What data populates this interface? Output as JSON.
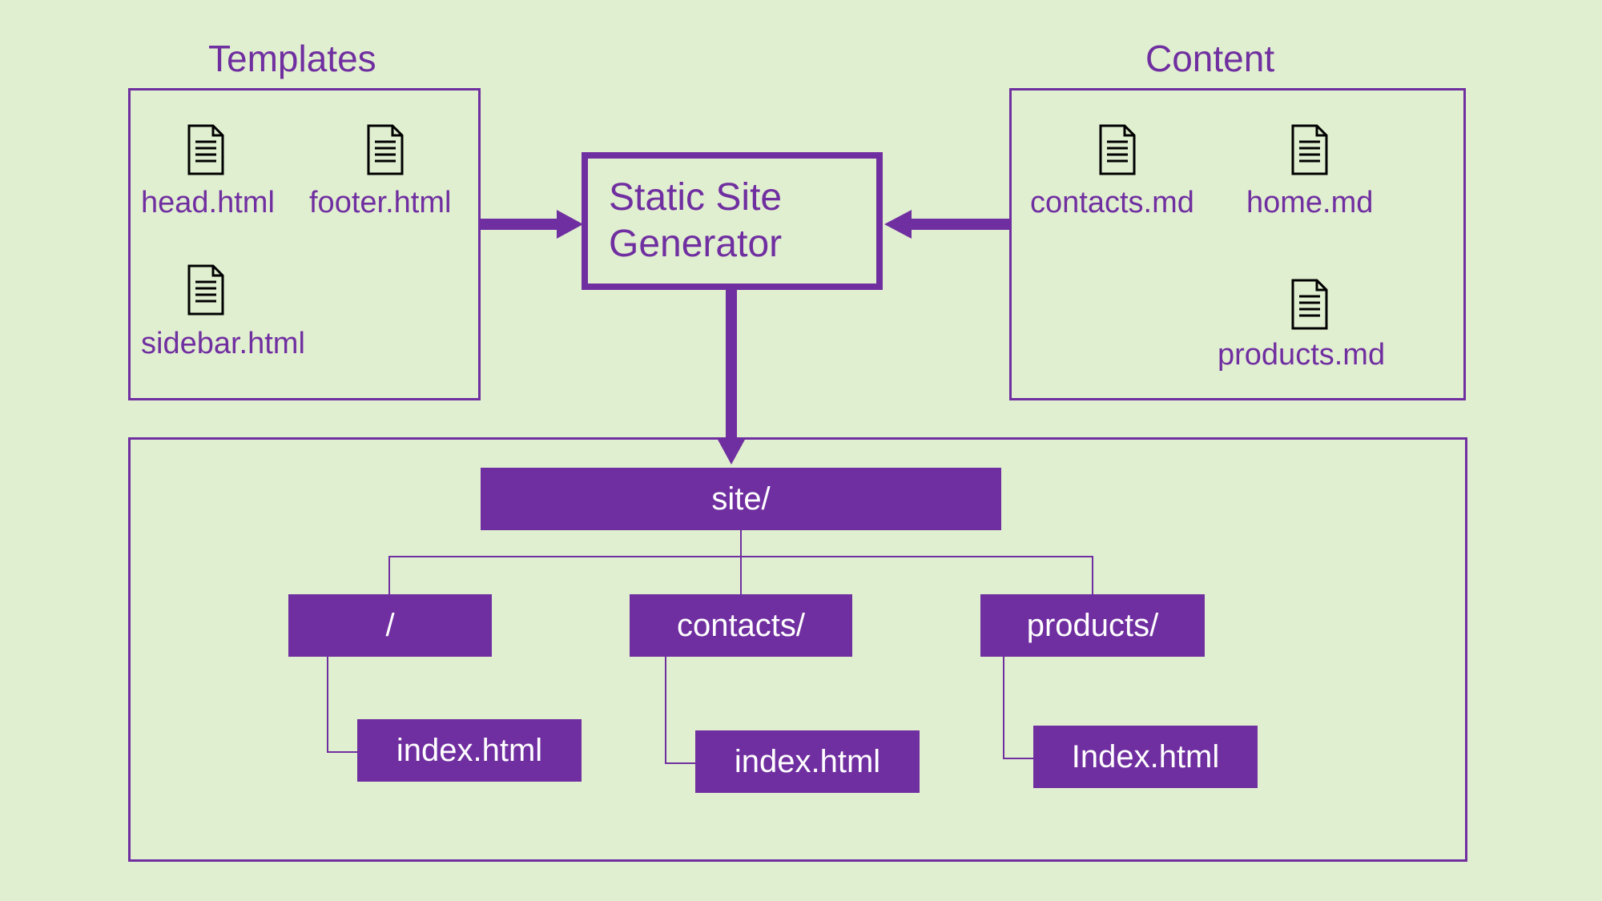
{
  "headings": {
    "templates": "Templates",
    "content": "Content"
  },
  "center": {
    "line1": "Static Site",
    "line2": "Generator"
  },
  "templates": {
    "files": [
      "head.html",
      "footer.html",
      "sidebar.html"
    ]
  },
  "content": {
    "files": [
      "contacts.md",
      "home.md",
      "products.md"
    ]
  },
  "tree": {
    "root": "site/",
    "dirs": [
      "/",
      "contacts/",
      "products/"
    ],
    "files": [
      "index.html",
      "index.html",
      "Index.html"
    ]
  }
}
